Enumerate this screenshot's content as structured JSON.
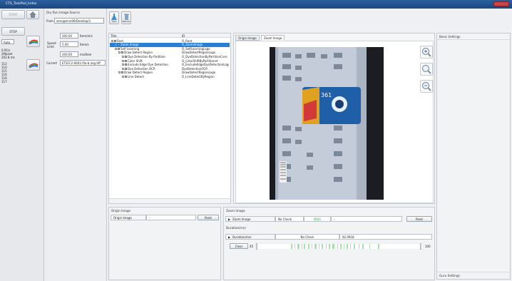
{
  "window": {
    "title": "CTS_TaskPad_Index"
  },
  "left": {
    "start_label": "START",
    "stop_label": "STOP",
    "mode_value": "Auto",
    "stats": [
      "0.91/s",
      "2Mpixel",
      "202.8 ms"
    ],
    "counters": [
      "112",
      "110",
      "115",
      "116",
      "116",
      "117"
    ]
  },
  "source": {
    "title": "Dry Run Image Source",
    "from_label": "From",
    "from_value": "zero@erve06/Desktop/1",
    "rate_value": "500.00",
    "rate_unit": "Item/m/s",
    "speed_label": "Speed\nLimit",
    "speed_value": "5.00",
    "speed_unit": "Item/s",
    "limit_value": "200.00",
    "limit_unit": "ms/Item",
    "current_label": "Current",
    "current_value": "ETSFC2-0001-fila-b.img.tiff"
  },
  "toolbar": {
    "tree_label": "Tree",
    "record_label": "Record"
  },
  "tree": {
    "col_title": "Title",
    "col_id": "ID",
    "rows": [
      {
        "title": "Root",
        "id": "O_Root",
        "indent": 0,
        "selected": false
      },
      {
        "title": "Zoom Image",
        "id": "O_ZoomImage",
        "indent": 1,
        "selected": true
      },
      {
        "title": "Self Learning",
        "id": "O_SelfLearningLogo",
        "indent": 1,
        "selected": false
      },
      {
        "title": "Draw Detect Region",
        "id": "DrawDetectRegionLogo",
        "indent": 2,
        "selected": false
      },
      {
        "title": "Dye Detection By Partition",
        "id": "O_DyeDetectionByPartitionCore",
        "indent": 3,
        "selected": false
      },
      {
        "title": "Color Shift",
        "id": "O_ColorShiftByPartitionet",
        "indent": 3,
        "selected": false
      },
      {
        "title": "Exclude Edge Dye Detection",
        "id": "O_ExcludeEdgeDyeDetectionLogo",
        "indent": 3,
        "selected": false
      },
      {
        "title": "Dye Detection OCR",
        "id": "DyeDetectionOCR",
        "indent": 3,
        "selected": false
      },
      {
        "title": "Draw Detect Region",
        "id": "DrawDetectRegionLogo",
        "indent": 2,
        "selected": false
      },
      {
        "title": "Line Detect",
        "id": "O_LineDetectByRegion",
        "indent": 3,
        "selected": false
      }
    ]
  },
  "view": {
    "tabs": [
      "Origin Image",
      "Zoom Image"
    ],
    "active_tab": 1,
    "zoom_in_label": "+",
    "zoom_fit_label": "",
    "zoom_out_label": "-",
    "card_text": "361"
  },
  "origin_panel": {
    "title": "Origin Image",
    "row_label": "Origin Image",
    "row_value": "-",
    "paint_label": "Paint"
  },
  "zoom_panel": {
    "title": "Zoom Image",
    "row_label": "Zoom Image",
    "check_label": "No Check",
    "status_value": "PASS",
    "dash": "-",
    "paint_label": "Paint",
    "duration_title": "Duration(ms)",
    "duration_label": "Duration(ms)",
    "duration_check": "No Check",
    "duration_value": "92.0918",
    "clear_label": "Clear",
    "range_min": "45",
    "range_max": "100"
  },
  "settings": {
    "basic_title": "Basic Settings",
    "guru_title": "Guru Settings"
  },
  "colors": {
    "accent": "#3b8fd6",
    "select": "#2a7fd4",
    "pass": "#28a745"
  }
}
